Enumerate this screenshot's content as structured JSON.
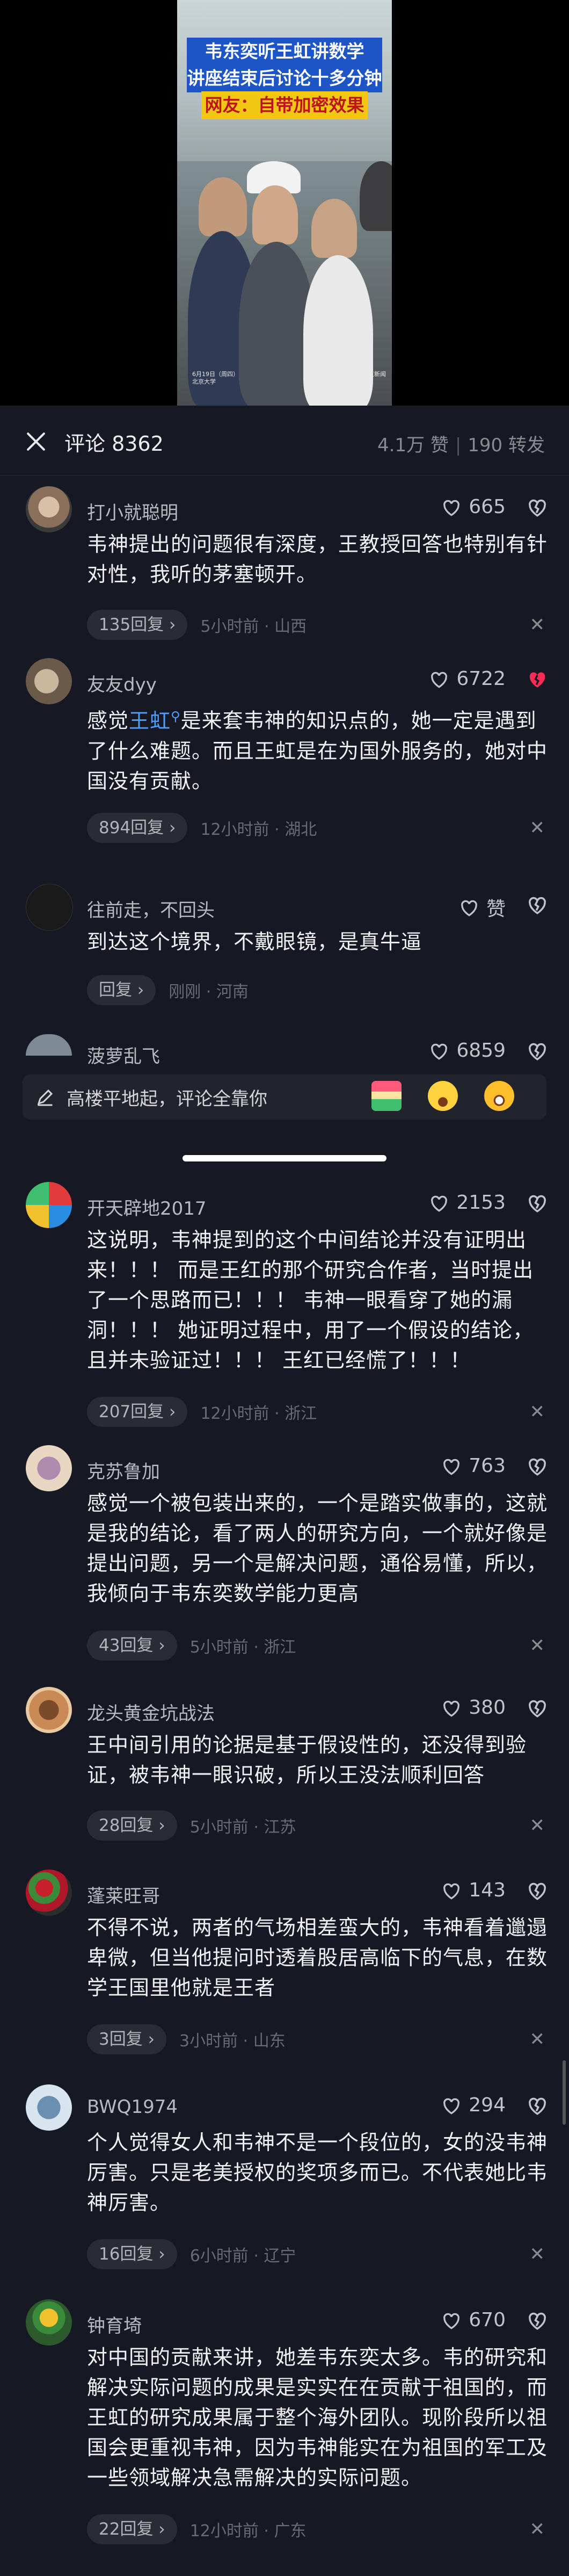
{
  "video": {
    "headline1": "韦东奕听王虹讲数学",
    "headline2": "讲座结束后讨论十多分钟",
    "headline3": "网友：自带加密效果",
    "meta_left": "6月19日（周四）\n北京大学",
    "meta_right": "来源：每日北京新闻\n编辑：刘洋"
  },
  "header": {
    "title": "评论 8362",
    "likes": "4.1万 赞",
    "shares": "190 转发"
  },
  "comments": [
    {
      "user": "打小就聪明",
      "text": "韦神提出的问题很有深度，王教授回答也特别有针对性，我听的茅塞顿开。",
      "likes": "665",
      "replies": "135回复",
      "meta": "5小时前 · 山西"
    },
    {
      "user": "友友dyy",
      "text_pre": "感觉",
      "text_link": "王虹",
      "text_post": "是来套韦神的知识点的，她一定是遇到了什么难题。而且王虹是在为国外服务的，她对中国没有贡献。",
      "likes": "6722",
      "replies": "894回复",
      "meta": "12小时前 · 湖北"
    },
    {
      "user": "往前走，不回头",
      "text": "到达这个境界，不戴眼镜，是真牛逼",
      "likes": "赞",
      "replies": "回复",
      "meta": "刚刚 · 河南"
    },
    {
      "user": "菠萝乱飞",
      "likes": "6859"
    },
    {
      "user": "开天辟地2017",
      "text": "这说明，韦神提到的这个中间结论并没有证明出来！！！ 而是王红的那个研究合作者，当时提出了一个思路而已！！！ 韦神一眼看穿了她的漏洞！！！ 她证明过程中，用了一个假设的结论，且并未验证过！！！ 王红已经慌了！！！",
      "likes": "2153",
      "replies": "207回复",
      "meta": "12小时前 · 浙江"
    },
    {
      "user": "克苏鲁加",
      "text": "感觉一个被包装出来的，一个是踏实做事的，这就是我的结论，看了两人的研究方向，一个就好像是提出问题，另一个是解决问题，通俗易懂，所以，我倾向于韦东奕数学能力更高",
      "likes": "763",
      "replies": "43回复",
      "meta": "5小时前 · 浙江"
    },
    {
      "user": "龙头黄金坑战法",
      "text": "王中间引用的论据是基于假设性的，还没得到验证，被韦神一眼识破，所以王没法顺利回答",
      "likes": "380",
      "replies": "28回复",
      "meta": "5小时前 · 江苏"
    },
    {
      "user": "蓬莱旺哥",
      "text": "不得不说，两者的气场相差蛮大的，韦神看着邋遢卑微，但当他提问时透着股居高临下的气息，在数学王国里他就是王者",
      "likes": "143",
      "replies": "3回复",
      "meta": "3小时前 · 山东"
    },
    {
      "user": "BWQ1974",
      "text": "个人觉得女人和韦神不是一个段位的，女的没韦神厉害。只是老美授权的奖项多而已。不代表她比韦神厉害。",
      "likes": "294",
      "replies": "16回复",
      "meta": "6小时前 · 辽宁"
    },
    {
      "user": "钟育埼",
      "text": "对中国的贡献来讲，她差韦东奕太多。韦的研究和解决实际问题的成果是实实在在贡献于祖国的，而王虹的研究成果属于整个海外团队。现阶段所以祖国会更重视韦神，因为韦神能实在为祖国的军工及一些领域解决急需解决的实际问题。",
      "likes": "670",
      "replies": "22回复",
      "meta": "12小时前 · 广东"
    }
  ],
  "input": {
    "placeholder": "高楼平地起，评论全靠你"
  },
  "colors": {
    "background": "#161823",
    "liked_heart": "#fe2c55",
    "link": "#4ea0ff"
  }
}
